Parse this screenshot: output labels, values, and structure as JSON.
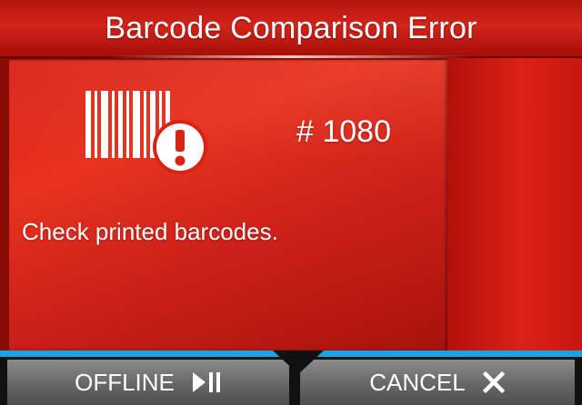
{
  "title": "Barcode Comparison Error",
  "error": {
    "number": "# 1080",
    "message": "Check printed barcodes.",
    "icon": "barcode-error-icon"
  },
  "softkeys": {
    "left": {
      "label": "OFFLINE",
      "icon": "play-pause-icon"
    },
    "right": {
      "label": "CANCEL",
      "icon": "close-icon"
    }
  },
  "colors": {
    "accent_line": "#1aa3e6",
    "error_red": "#d81f14",
    "softkey_gray": "#6a6a6a"
  }
}
